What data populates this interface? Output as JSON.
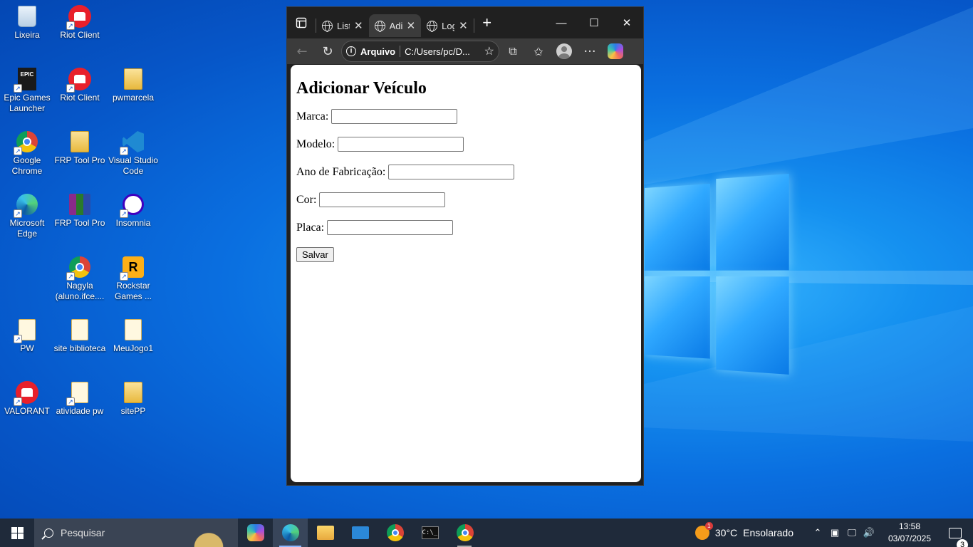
{
  "desktop": {
    "icons": [
      {
        "label": "Lixeira",
        "icon": "recycle-bin-icon"
      },
      {
        "label": "Riot Client",
        "icon": "riot-client-icon"
      },
      {
        "label": "Epic Games Launcher",
        "icon": "epic-games-icon"
      },
      {
        "label": "Riot Client",
        "icon": "riot-client-icon"
      },
      {
        "label": "pwmarcela",
        "icon": "folder-icon"
      },
      {
        "label": "Google Chrome",
        "icon": "chrome-icon"
      },
      {
        "label": "FRP Tool Pro",
        "icon": "folder-icon"
      },
      {
        "label": "Visual Studio Code",
        "icon": "vscode-icon"
      },
      {
        "label": "Microsoft Edge",
        "icon": "edge-icon"
      },
      {
        "label": "FRP Tool Pro",
        "icon": "winrar-icon"
      },
      {
        "label": "Insomnia",
        "icon": "insomnia-icon"
      },
      {
        "label": "Nagyla (aluno.ifce....",
        "icon": "chrome-profile-icon"
      },
      {
        "label": "Rockstar Games ...",
        "icon": "rockstar-icon"
      },
      {
        "label": "PW",
        "icon": "document-icon"
      },
      {
        "label": "site biblioteca",
        "icon": "document-icon"
      },
      {
        "label": "MeuJogo1",
        "icon": "document-icon"
      },
      {
        "label": "VALORANT",
        "icon": "valorant-icon"
      },
      {
        "label": "atividade pw",
        "icon": "document-icon"
      },
      {
        "label": "sitePP",
        "icon": "folder-icon"
      }
    ]
  },
  "browser": {
    "tabs": [
      {
        "label": "List",
        "active": false
      },
      {
        "label": "Adi",
        "active": true
      },
      {
        "label": "Log",
        "active": false
      }
    ],
    "address": {
      "site_label": "Arquivo",
      "url": "C:/Users/pc/D..."
    },
    "page": {
      "heading": "Adicionar Veículo",
      "fields": [
        {
          "label": "Marca:",
          "value": ""
        },
        {
          "label": "Modelo:",
          "value": ""
        },
        {
          "label": "Ano de Fabricação:",
          "value": ""
        },
        {
          "label": "Cor:",
          "value": ""
        },
        {
          "label": "Placa:",
          "value": ""
        }
      ],
      "save_label": "Salvar"
    }
  },
  "taskbar": {
    "search_placeholder": "Pesquisar",
    "weather": {
      "temp": "30°C",
      "condition": "Ensolarado",
      "badge": "1"
    },
    "time": "13:58",
    "date": "03/07/2025",
    "notification_count": "3"
  },
  "colors": {
    "accent": "#0a6fe0",
    "browser_frame": "#202020",
    "riot_red": "#e8202b"
  }
}
